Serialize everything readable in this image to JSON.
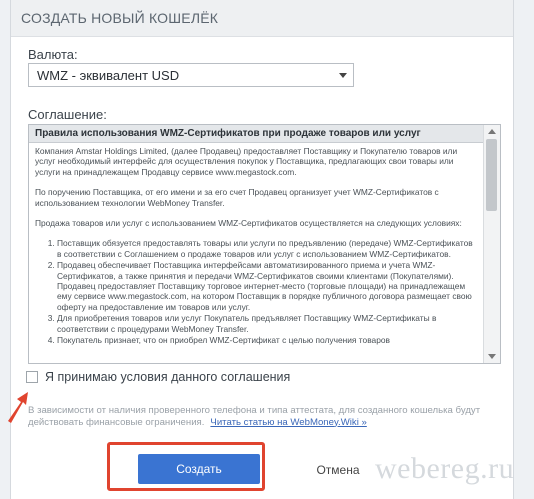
{
  "dialog": {
    "title": "СОЗДАТЬ НОВЫЙ КОШЕЛЁК",
    "currency_label": "Валюта:",
    "currency_value": "WMZ - эквивалент USD",
    "agreement_label": "Соглашение:",
    "agreement": {
      "heading": "Правила использования WMZ-Сертификатов при продаже товаров или услуг",
      "paragraphs": [
        "Компания Amstar Holdings Limited, (далее Продавец) предоставляет Поставщику и Покупателю товаров или услуг необходимый интерфейс для осуществления покупок у Поставщика, предлагающих свои товары или услуги на принадлежащем Продавцу сервисе www.megastock.com.",
        "По поручению Поставщика, от его имени и за его счет Продавец организует учет WMZ-Сертификатов с использованием технологии WebMoney Transfer.",
        "Продажа товаров или услуг с использованием WMZ-Сертификатов осуществляется на следующих условиях:"
      ],
      "items": [
        "Поставщик обязуется предоставлять товары или услуги по предъявлению (передаче) WMZ-Сертификатов в соответствии с Соглашением о продаже товаров или услуг с использованием WMZ-Сертификатов.",
        "Продавец обеспечивает Поставщика интерфейсами автоматизированного приема и учета WMZ-Сертификатов, а также принятия и передачи WMZ-Сертификатов своими клиентами (Покупателями). Продавец предоставляет Поставщику торговое интернет-место (торговые площади) на принадлежащем ему сервисе www.megastock.com, на котором Поставщик в порядке публичного договора размещает свою оферту на предоставление им товаров или услуг.",
        "Для приобретения товаров или услуг Покупатель предъявляет Поставщику WMZ-Сертификаты в соответствии с процедурами WebMoney Transfer.",
        "Покупатель признает, что он приобрел WMZ-Сертификат с целью получения товаров"
      ]
    },
    "agree_label": "Я принимаю условия данного соглашения",
    "notice_text": "В зависимости от наличия проверенного телефона и типа аттестата, для созданного кошелька будут действовать финансовые ограничения.",
    "notice_link": "Читать статью на WebMoney.Wiki »",
    "create_label": "Создать",
    "cancel_label": "Отмена"
  },
  "watermark": "webereg.ru",
  "colors": {
    "accent": "#3a74d2",
    "highlight": "#e0442f",
    "header_bg": "#eef0f2",
    "link": "#3a67b8"
  }
}
